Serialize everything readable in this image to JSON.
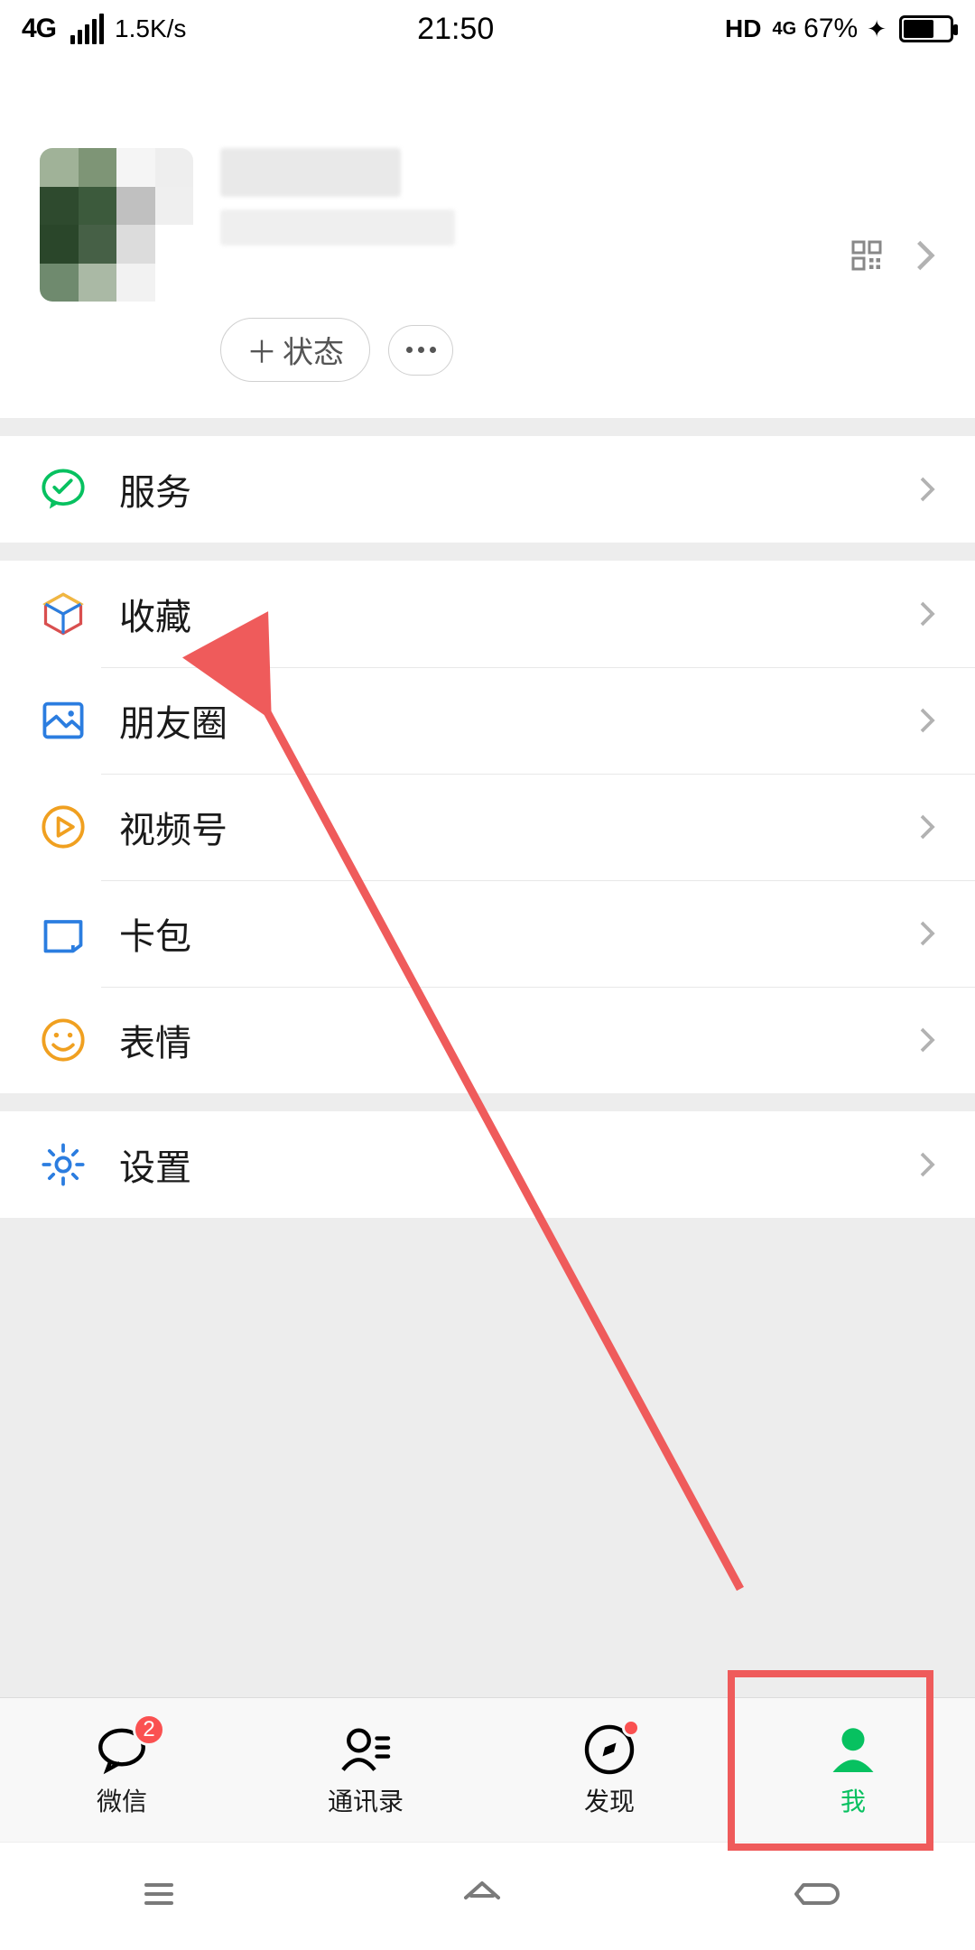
{
  "status_bar": {
    "network": "4G",
    "speed": "1.5K/s",
    "time": "21:50",
    "hd": "HD",
    "net2": "4G",
    "battery_pct": "67%"
  },
  "profile": {
    "status_button": "状态"
  },
  "menu": {
    "services": "服务",
    "favorites": "收藏",
    "moments": "朋友圈",
    "channels": "视频号",
    "cards": "卡包",
    "stickers": "表情",
    "settings": "设置"
  },
  "tabs": {
    "wechat": "微信",
    "wechat_badge": "2",
    "contacts": "通讯录",
    "discover": "发现",
    "me": "我"
  },
  "colors": {
    "accent": "#07c160",
    "annotation": "#ef5b5b"
  }
}
